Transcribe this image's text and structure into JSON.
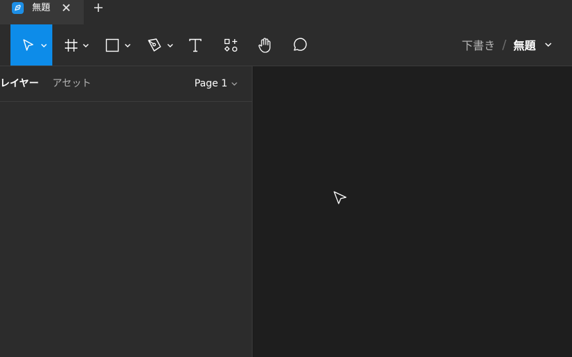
{
  "tab": {
    "title": "無題"
  },
  "toolbar": {
    "tools": [
      "move-tool",
      "frame-tool",
      "shape-tool",
      "pen-tool",
      "text-tool",
      "resources-tool",
      "hand-tool",
      "comment-tool"
    ],
    "breadcrumb": {
      "drafts": "下書き",
      "separator": "/",
      "file": "無題"
    },
    "accent": "#0d8ce9"
  },
  "panel": {
    "tabs": {
      "layers": "レイヤー",
      "assets": "アセット"
    },
    "page": "Page 1"
  }
}
